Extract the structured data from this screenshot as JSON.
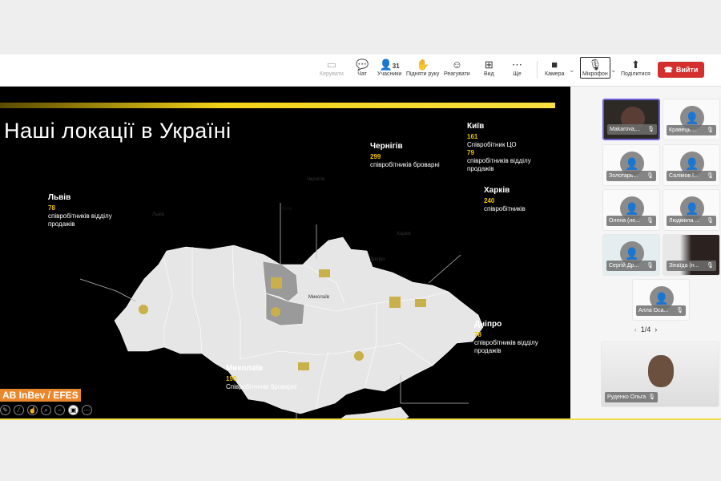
{
  "toolbar": {
    "share_screen": "Керувати",
    "chat": "Чат",
    "participants": "Учасники",
    "participants_count": "31",
    "raise_hand": "Підняти руку",
    "react": "Реагувати",
    "view": "Вид",
    "more": "Ще",
    "camera": "Камера",
    "microphone": "Мікрофон",
    "share": "Поділитися",
    "leave": "Вийти"
  },
  "slide": {
    "title": "Наші локації в Україні",
    "logo": "AB InBev / EFES",
    "cities": [
      {
        "name": "Львів",
        "count": "78",
        "desc": "співробітників відділу продажів",
        "map_label": "Львів"
      },
      {
        "name": "Чернігів",
        "count": "299",
        "desc": "співробітників броварні",
        "map_label": "Чернігів"
      },
      {
        "name": "Київ",
        "count": "161",
        "desc": "Співробітник ЦО",
        "count2": "79",
        "desc2": "співробітників відділу продажів",
        "map_label": "Київ"
      },
      {
        "name": "Харків",
        "count": "240",
        "desc": "співробітників",
        "map_label": "Харків"
      },
      {
        "name": "Дніпро",
        "count": "78",
        "desc": "співробітників відділу продажів",
        "map_label": "Дніпро"
      },
      {
        "name": "Миколаїв",
        "count": "190",
        "desc": "Співробітників броварні",
        "map_label": "Миколаїв"
      }
    ]
  },
  "participants": [
    {
      "name": "Makarova,...",
      "video": true
    },
    {
      "name": "Кравець ..."
    },
    {
      "name": "Золотарь..."
    },
    {
      "name": "Салімов І..."
    },
    {
      "name": "Олена (не..."
    },
    {
      "name": "Людмила ..."
    },
    {
      "name": "Сергій Др..."
    },
    {
      "name": "Зінаїда (н...",
      "video": true
    },
    {
      "name": "Алла Оса..."
    }
  ],
  "pager": "1/4",
  "self_view": {
    "name": "Руденко Ольга"
  },
  "colors": {
    "accent": "#f2c500",
    "leave": "#d32f2f",
    "logo": "#e8872b"
  }
}
